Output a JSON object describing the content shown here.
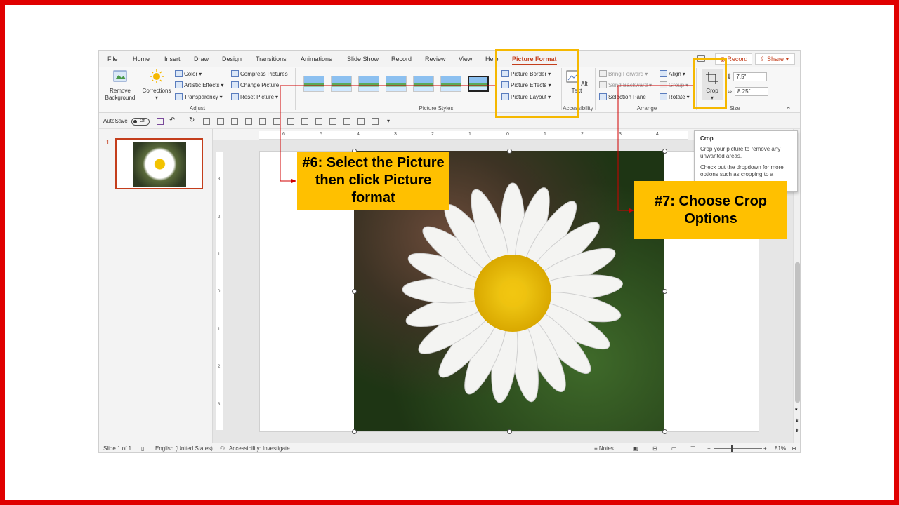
{
  "tabs": [
    "File",
    "Home",
    "Insert",
    "Draw",
    "Design",
    "Transitions",
    "Animations",
    "Slide Show",
    "Record",
    "Review",
    "View",
    "Help",
    "Picture Format"
  ],
  "active_tab": "Picture Format",
  "header_buttons": {
    "record": "Record",
    "share": "Share"
  },
  "ribbon": {
    "adjust": {
      "remove_background": "Remove Background",
      "corrections": "Corrections",
      "color": "Color",
      "artistic_effects": "Artistic Effects",
      "transparency": "Transparency",
      "compress": "Compress Pictures",
      "change": "Change Picture",
      "reset": "Reset Picture",
      "label": "Adjust"
    },
    "picture_styles": {
      "border": "Picture Border",
      "effects": "Picture Effects",
      "layout": "Picture Layout",
      "label": "Picture Styles"
    },
    "accessibility": {
      "alt_text": "Alt Text",
      "label": "Accessibility"
    },
    "arrange": {
      "bring_forward": "Bring Forward",
      "send_backward": "Send Backward",
      "selection_pane": "Selection Pane",
      "align": "Align",
      "group": "Group",
      "rotate": "Rotate",
      "label": "Arrange"
    },
    "size": {
      "crop": "Crop",
      "height": "7.5\"",
      "width": "8.25\"",
      "label": "Size"
    }
  },
  "qat": {
    "autosave": "AutoSave",
    "toggle": "Off"
  },
  "thumbnail_number": "1",
  "ruler_top": [
    "6",
    "5",
    "4",
    "3",
    "2",
    "1",
    "0",
    "1",
    "2",
    "3",
    "4"
  ],
  "ruler_left": [
    "3",
    "2",
    "1",
    "0",
    "1",
    "2",
    "3"
  ],
  "tooltip": {
    "title": "Crop",
    "line1": "Crop your picture to remove any unwanted areas.",
    "line2": "Check out the dropdown for more options such as cropping to a"
  },
  "status": {
    "slide": "Slide 1 of 1",
    "language": "English (United States)",
    "accessibility": "Accessibility: Investigate",
    "notes": "Notes",
    "zoom": "81%"
  },
  "callouts": {
    "step6": "#6: Select the Picture then click Picture format",
    "step7": "#7: Choose Crop Options"
  },
  "colors": {
    "accent": "#c43e1c",
    "callout": "#ffc000",
    "highlight": "#f5b800",
    "frame": "#e00000"
  }
}
